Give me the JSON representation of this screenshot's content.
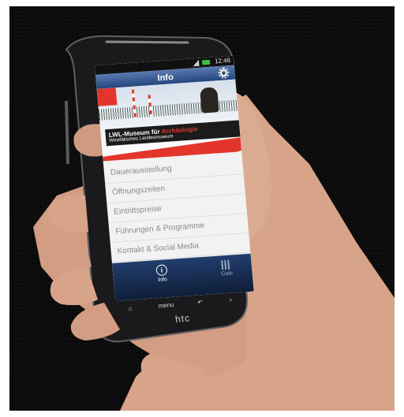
{
  "status_bar": {
    "time": "12:46"
  },
  "app": {
    "title": "Info"
  },
  "banner": {
    "line1_prefix": "LWL-Museum für",
    "line1_accent": "Archäologie",
    "line2": "Westfälisches Landesmuseum"
  },
  "menu_items": [
    "Dauerausstellung",
    "Öffnungszeiten",
    "Eintrittspreise",
    "Führungen & Programme",
    "Kontakt & Social Media"
  ],
  "bottom_tabs": {
    "info_label": "Info",
    "other_label": "Gale"
  },
  "hardware_keys": {
    "menu": "menu"
  },
  "brand": "htc",
  "colors": {
    "accent_red": "#e3352b",
    "title_blue": "#24467e",
    "background": "#0b0b0c"
  }
}
